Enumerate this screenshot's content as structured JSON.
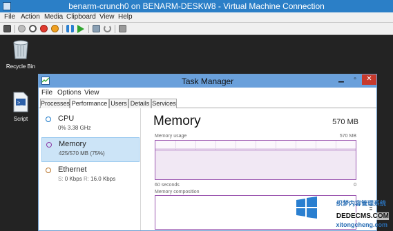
{
  "vm_window": {
    "title": "benarm-crunch0 on BENARM-DESKW8 - Virtual Machine Connection",
    "menu": [
      "File",
      "Action",
      "Media",
      "Clipboard",
      "View",
      "Help"
    ],
    "toolbar_icons": [
      "ctrl-alt-del-icon",
      "start-icon",
      "turn-off-icon",
      "shut-down-icon",
      "save-icon",
      "pause-icon",
      "resume-icon",
      "checkpoint-icon",
      "revert-icon",
      "enhanced-session-icon"
    ]
  },
  "desktop": {
    "icons": [
      {
        "label": "Recycle Bin",
        "icon": "recycle-bin-icon"
      },
      {
        "label": "Script",
        "icon": "script-file-icon"
      }
    ]
  },
  "task_manager": {
    "title": "Task Manager",
    "menu": [
      "File",
      "Options",
      "View"
    ],
    "tabs": [
      "Processes",
      "Performance",
      "Users",
      "Details",
      "Services"
    ],
    "active_tab": "Performance",
    "resources": [
      {
        "name": "CPU",
        "sub": "0% 3.38 GHz",
        "color": "#1b79c9"
      },
      {
        "name": "Memory",
        "sub": "425/570 MB (75%)",
        "color": "#8b3aa6",
        "selected": true
      },
      {
        "name": "Ethernet",
        "sub_s_label": "S:",
        "sub_s": "0 Kbps",
        "sub_r_label": "R:",
        "sub_r": "16.0 Kbps",
        "color": "#b8742a"
      }
    ],
    "detail": {
      "title": "Memory",
      "total": "570 MB",
      "usage_label": "Memory usage",
      "usage_max": "570 MB",
      "usage_fraction": 0.75,
      "x_left": "60 seconds",
      "x_right": "0",
      "composition_label": "Memory composition"
    },
    "colors": {
      "accent": "#8b3aa6",
      "titlebar": "#6aa0db"
    }
  },
  "watermark": {
    "line1": "织梦内容管理系统",
    "line2": "DEDECMS.COM",
    "line3": "xitongcheng.com"
  }
}
